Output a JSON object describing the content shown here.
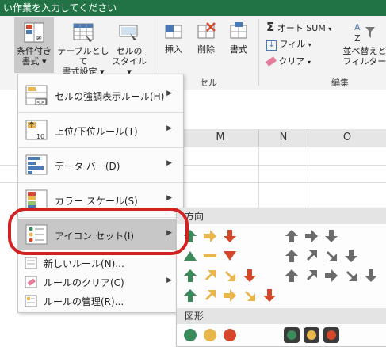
{
  "titlebar": {
    "text": "い作業を入力してください"
  },
  "ribbon": {
    "cond_format": {
      "line1": "条件付き",
      "line2": "書式 ▾"
    },
    "table_format": {
      "line1": "テーブルとして",
      "line2": "書式設定 ▾"
    },
    "cell_style": {
      "line1": "セルの",
      "line2": "スタイル ▾"
    },
    "insert": "挿入",
    "delete": "削除",
    "format": "書式",
    "cells_group": "セル",
    "autosum": "オート SUM",
    "fill": "フィル",
    "clear": "クリア",
    "sort_filter": {
      "line1": "並べ替えと",
      "line2": "フィルター"
    },
    "editing_group": "編集"
  },
  "columns": [
    "M",
    "N",
    "O"
  ],
  "menu": {
    "items": [
      {
        "label": "セルの強調表示ルール(H)",
        "icon": "highlight-rules-icon"
      },
      {
        "label": "上位/下位ルール(T)",
        "icon": "top-bottom-icon"
      },
      {
        "label": "データ バー(D)",
        "icon": "databar-icon"
      },
      {
        "label": "カラー スケール(S)",
        "icon": "color-scale-icon"
      },
      {
        "label": "アイコン セット(I)",
        "icon": "icon-sets-icon"
      },
      {
        "label": "新しいルール(N)...",
        "icon": "new-rule-icon"
      },
      {
        "label": "ルールのクリア(C)",
        "icon": "clear-rules-icon"
      },
      {
        "label": "ルールの管理(R)...",
        "icon": "manage-rules-icon"
      }
    ]
  },
  "submenu": {
    "section_direction": "方向",
    "section_shapes": "図形"
  },
  "colors": {
    "accent_green": "#217346",
    "arrow_green": "#3a8a5a",
    "arrow_yellow": "#e8b64a",
    "arrow_red": "#d5472b",
    "arrow_gray": "#6b6b6b",
    "highlight_ring": "#d32020"
  }
}
